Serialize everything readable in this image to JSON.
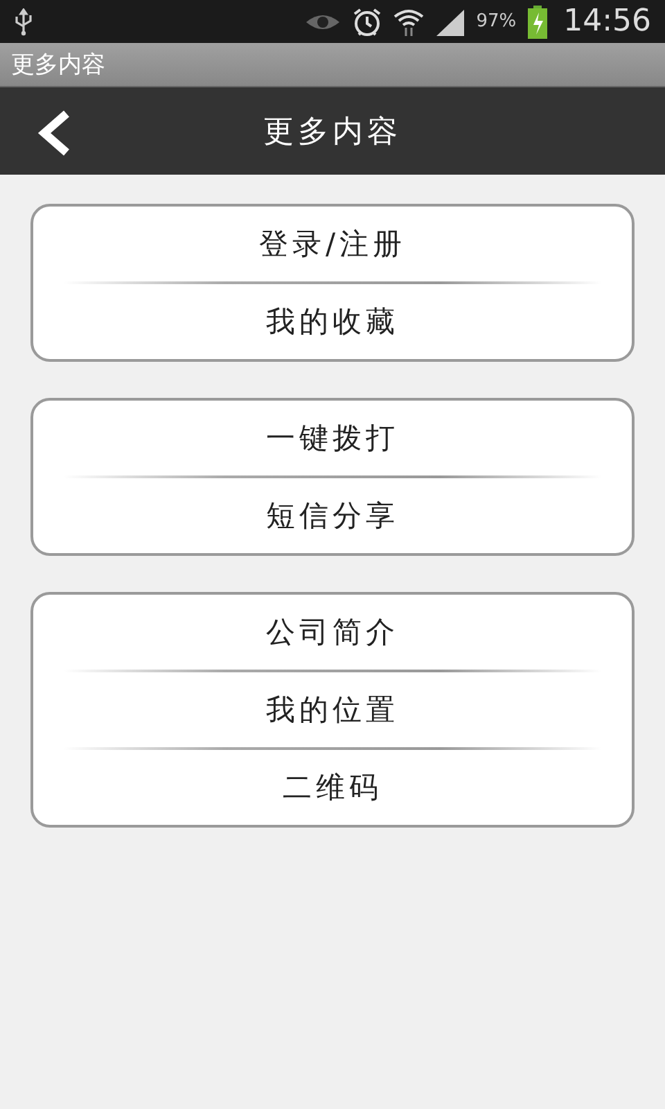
{
  "status_bar": {
    "battery_text": "97%",
    "time": "14:56"
  },
  "app_title": "更多内容",
  "header": {
    "title": "更多内容"
  },
  "groups": [
    {
      "items": [
        {
          "label": "登录/注册"
        },
        {
          "label": "我的收藏"
        }
      ]
    },
    {
      "items": [
        {
          "label": "一键拨打"
        },
        {
          "label": "短信分享"
        }
      ]
    },
    {
      "items": [
        {
          "label": "公司简介"
        },
        {
          "label": "我的位置"
        },
        {
          "label": "二维码"
        }
      ]
    }
  ]
}
